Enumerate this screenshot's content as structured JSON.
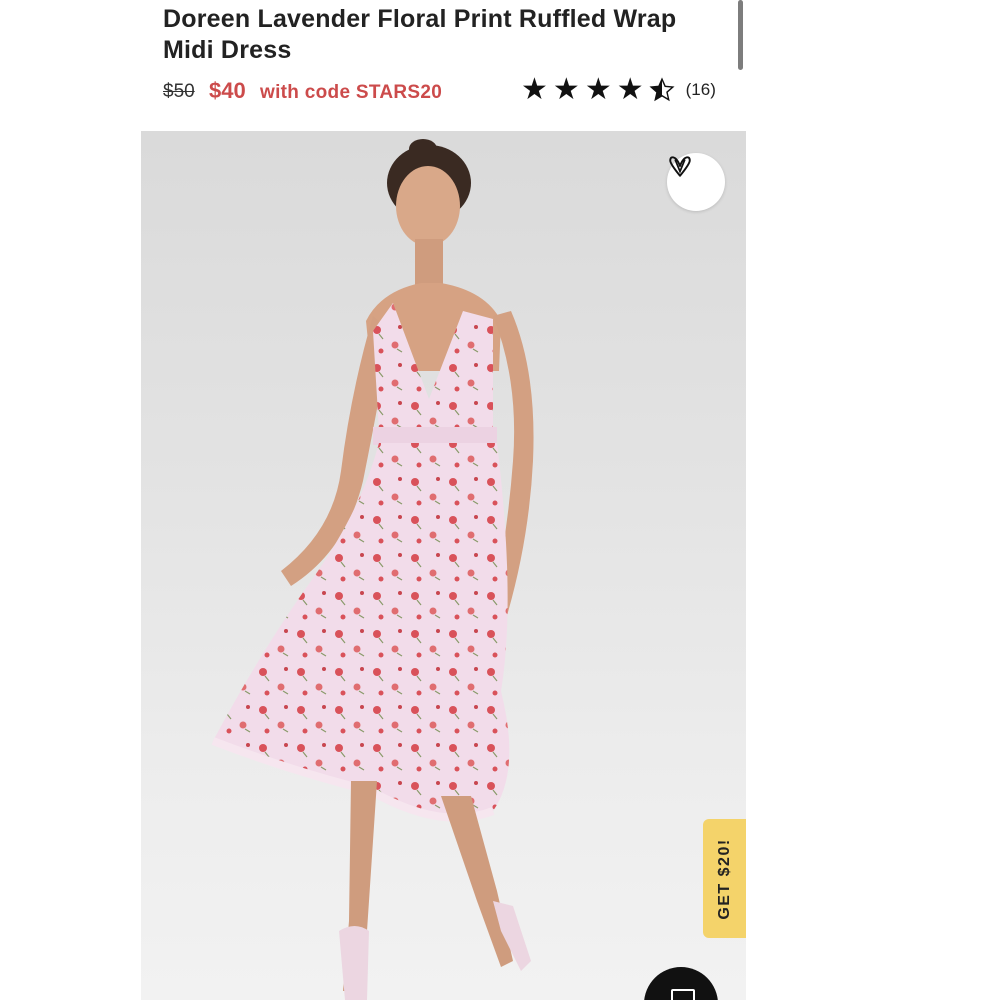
{
  "product": {
    "title": "Doreen Lavender Floral Print Ruffled Wrap Midi Dress",
    "original_price": "$50",
    "sale_price": "$40",
    "promo_text": "with code STARS20",
    "rating": {
      "value": 4.5,
      "max": 5,
      "count_label": "(16)"
    }
  },
  "image": {
    "wishlist_icon": "heart-v-icon",
    "promo_tab_label": "GET $20!",
    "chat_icon": "chat-icon"
  },
  "colors": {
    "price_accent": "#cc4b4b",
    "promo_tab": "#f4d36a",
    "dress": "#f2dcea",
    "flowers": "#d9525a"
  }
}
